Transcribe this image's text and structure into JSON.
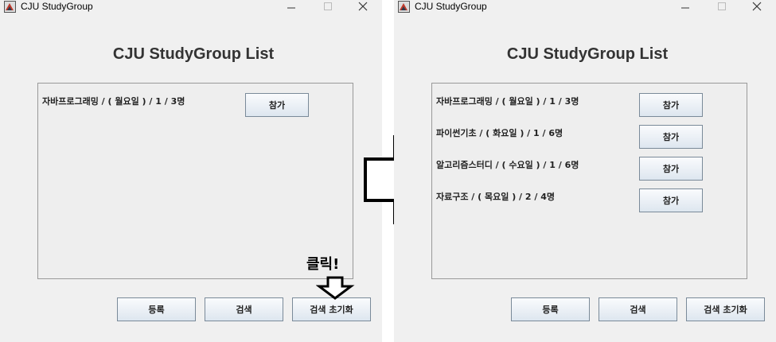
{
  "left_window": {
    "title": "CJU StudyGroup",
    "heading": "CJU StudyGroup List",
    "rows": [
      {
        "label": "자바프로그래밍 / ( 월요일 ) / 1 / 3명",
        "button": "참가"
      }
    ],
    "buttons": {
      "register": "등록",
      "search": "검색",
      "reset": "검색 초기화"
    }
  },
  "right_window": {
    "title": "CJU StudyGroup",
    "heading": "CJU StudyGroup List",
    "rows": [
      {
        "label": "자바프로그래밍 / ( 월요일 ) / 1 / 3명",
        "button": "참가"
      },
      {
        "label": "파이썬기초 / ( 화요일 ) / 1 / 6명",
        "button": "참가"
      },
      {
        "label": "알고리즘스터디 / ( 수요일 ) / 1 / 6명",
        "button": "참가"
      },
      {
        "label": "자료구조 / ( 목요일 ) / 2 / 4명",
        "button": "참가"
      }
    ],
    "buttons": {
      "register": "등록",
      "search": "검색",
      "reset": "검색 초기화"
    }
  },
  "annotation": {
    "click_note": "클릭!"
  },
  "icons": [
    "app-icon",
    "minimize-icon",
    "maximize-icon",
    "close-icon",
    "right-arrow-icon",
    "down-arrow-icon"
  ],
  "colors": {
    "window_bg": "#f0f0f0",
    "panel_border": "#999999",
    "button_border": "#7a8a99"
  }
}
